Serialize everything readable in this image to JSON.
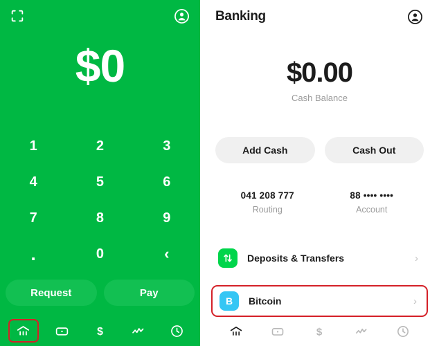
{
  "colors": {
    "brand_green": "#00b843",
    "pill_green": "#12c052",
    "highlight_red": "#d42027",
    "bitcoin_blue": "#35c6f4",
    "deposits_green": "#00d54b",
    "gray_pill": "#f0f0f0",
    "muted_text": "#9b9b9b",
    "dark_text": "#1c1c1c"
  },
  "left_panel": {
    "scan_icon": "scan-qr-icon",
    "profile_icon": "profile-avatar-icon",
    "amount": "$0",
    "keypad": [
      {
        "label": "1",
        "name": "key-1"
      },
      {
        "label": "2",
        "name": "key-2"
      },
      {
        "label": "3",
        "name": "key-3"
      },
      {
        "label": "4",
        "name": "key-4"
      },
      {
        "label": "5",
        "name": "key-5"
      },
      {
        "label": "6",
        "name": "key-6"
      },
      {
        "label": "7",
        "name": "key-7"
      },
      {
        "label": "8",
        "name": "key-8"
      },
      {
        "label": "9",
        "name": "key-9"
      },
      {
        "label": ".",
        "name": "key-decimal"
      },
      {
        "label": "0",
        "name": "key-0"
      },
      {
        "label": "‹",
        "name": "key-backspace"
      }
    ],
    "request_label": "Request",
    "pay_label": "Pay",
    "nav": [
      {
        "icon": "bank-icon",
        "name": "nav-banking",
        "active": true,
        "highlighted": true
      },
      {
        "icon": "card-icon",
        "name": "nav-card",
        "active": false,
        "highlighted": false
      },
      {
        "icon": "dollar-icon",
        "name": "nav-payments",
        "active": false,
        "highlighted": false
      },
      {
        "icon": "line-chart-icon",
        "name": "nav-investing",
        "active": false,
        "highlighted": false
      },
      {
        "icon": "clock-icon",
        "name": "nav-activity",
        "active": false,
        "highlighted": false
      }
    ]
  },
  "right_panel": {
    "title": "Banking",
    "profile_icon": "profile-avatar-icon",
    "balance": "$0.00",
    "balance_label": "Cash Balance",
    "add_cash_label": "Add Cash",
    "cash_out_label": "Cash Out",
    "routing_value": "041 208 777",
    "routing_label": "Routing",
    "account_value": "88 •••• ••••",
    "account_label": "Account",
    "rows": [
      {
        "label": "Deposits & Transfers",
        "icon": "transfer-arrows-icon",
        "badge": "",
        "highlighted": false
      },
      {
        "label": "Bitcoin",
        "icon": "bitcoin-icon",
        "badge": "B",
        "highlighted": true
      }
    ],
    "chevron": "›",
    "nav": [
      {
        "icon": "bank-icon",
        "name": "nav-banking",
        "active": true
      },
      {
        "icon": "card-icon",
        "name": "nav-card",
        "active": false
      },
      {
        "icon": "dollar-icon",
        "name": "nav-payments",
        "active": false
      },
      {
        "icon": "line-chart-icon",
        "name": "nav-investing",
        "active": false
      },
      {
        "icon": "clock-icon",
        "name": "nav-activity",
        "active": false
      }
    ]
  }
}
